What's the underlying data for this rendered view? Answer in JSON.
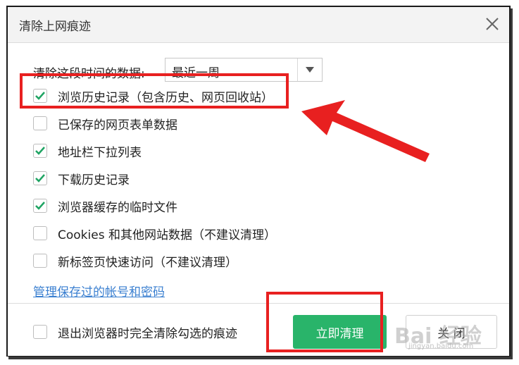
{
  "window": {
    "title": "清除上网痕迹"
  },
  "time_range": {
    "label": "清除这段时间的数据:",
    "selected": "最近一周"
  },
  "options": [
    {
      "label": "浏览历史记录（包含历史、网页回收站）",
      "checked": true
    },
    {
      "label": "已保存的网页表单数据",
      "checked": false
    },
    {
      "label": "地址栏下拉列表",
      "checked": true
    },
    {
      "label": "下载历史记录",
      "checked": true
    },
    {
      "label": "浏览器缓存的临时文件",
      "checked": true
    },
    {
      "label": "Cookies 和其他网站数据（不建议清理）",
      "checked": false
    },
    {
      "label": "新标签页快速访问（不建议清理）",
      "checked": false
    }
  ],
  "manage_link": "管理保存过的帐号和密码",
  "footer": {
    "exit_clear_label": "退出浏览器时完全清除勾选的痕迹",
    "exit_clear_checked": false,
    "clear_button": "立即清理",
    "close_button": "关 闭"
  },
  "watermark": {
    "text": "Bai 经验",
    "sub": "jingyan.baidu.com"
  },
  "colors": {
    "accent_green": "#29b46a",
    "check_green": "#1fa463",
    "annotation_red": "#e82020",
    "link_blue": "#3a7fd0"
  }
}
